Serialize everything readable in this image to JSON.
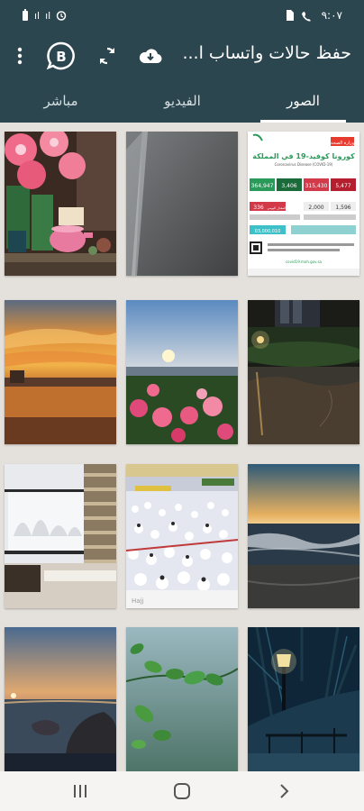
{
  "status_bar": {
    "time": "٩:٠٧",
    "signal_1": "ıl",
    "signal_2": "ıl"
  },
  "app_bar": {
    "title": "حفظ حالات واتساب ا...",
    "icons": [
      "cloud-download-icon",
      "refresh-icon",
      "whatsapp-business-icon",
      "more-vert-icon"
    ]
  },
  "tabs": [
    {
      "label": "الصور",
      "active": true
    },
    {
      "label": "الفيديو",
      "active": false
    },
    {
      "label": "مباشر",
      "active": false
    }
  ],
  "thumbnails": [
    {
      "name": "thumb-covid-statistics",
      "covid_card": {
        "header_logo": "وزارة الصحة",
        "headline": "كورونا كوفيد-19 في المملكة",
        "subline": "Coronavirus Disease (COVID-19)",
        "stats": [
          "364,947",
          "3,406",
          "315,430",
          "5,477"
        ],
        "stats2": [
          "336",
          "المعدل اليومي",
          "2,000",
          "1,596"
        ],
        "phone": "03,000,010",
        "footer": "covid19.moh.gov.sa"
      }
    },
    {
      "name": "thumb-gray-blur"
    },
    {
      "name": "thumb-flowers-pink"
    },
    {
      "name": "thumb-night-park"
    },
    {
      "name": "thumb-sunset-roses"
    },
    {
      "name": "thumb-orange-sunset"
    },
    {
      "name": "thumb-ocean-shore"
    },
    {
      "name": "thumb-pilgrims-crowd",
      "caption": "Hajj"
    },
    {
      "name": "thumb-snowy-window"
    },
    {
      "name": "thumb-lamp-post"
    },
    {
      "name": "thumb-green-leaves"
    },
    {
      "name": "thumb-dusk-rocks"
    }
  ],
  "nav_bar": {
    "icons": [
      "recent-apps-icon",
      "home-icon",
      "back-icon"
    ]
  }
}
